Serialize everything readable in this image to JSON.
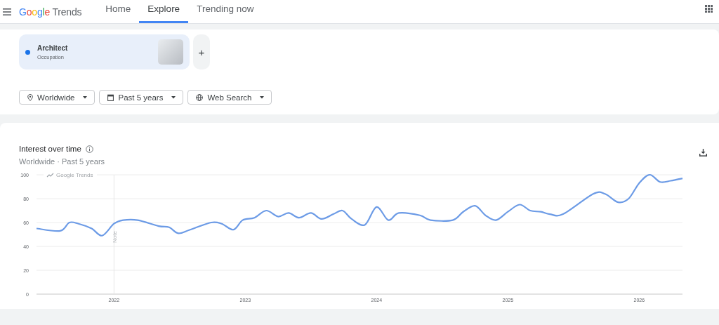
{
  "header": {
    "logo": "Google Trends",
    "nav": [
      {
        "label": "Home",
        "selected": false
      },
      {
        "label": "Explore",
        "selected": true
      },
      {
        "label": "Trending now",
        "selected": false
      }
    ]
  },
  "terms": [
    {
      "name": "Architect",
      "category": "Occupation",
      "color": "#1a73e8"
    }
  ],
  "add_term": {
    "label": "+"
  },
  "filters": [
    {
      "kind": "location",
      "label": "Worldwide"
    },
    {
      "kind": "time",
      "label": "Past 5 years"
    },
    {
      "kind": "property",
      "label": "Web Search"
    }
  ],
  "interest_over_time": {
    "title": "Interest over time",
    "subtitle": "Worldwide · Past 5 years",
    "chart_badge": "Google Trends",
    "chart_data": {
      "type": "line",
      "xlim": [
        2021.41,
        2026.33
      ],
      "ylim": [
        0,
        100
      ],
      "xticks": [
        {
          "value": 2022,
          "label": "2022"
        },
        {
          "value": 2023,
          "label": "2023"
        },
        {
          "value": 2024,
          "label": "2024"
        },
        {
          "value": 2025,
          "label": "2025"
        },
        {
          "value": 2026,
          "label": "2026"
        }
      ],
      "yticks": [
        0,
        20,
        40,
        60,
        80,
        100
      ],
      "grid": true,
      "ref_lines": [
        {
          "axis": "x",
          "value": 2022,
          "label": "Note"
        }
      ],
      "x": [
        2021.41,
        2021.59,
        2021.66,
        2021.73,
        2021.83,
        2021.91,
        2022.0,
        2022.07,
        2022.18,
        2022.34,
        2022.42,
        2022.49,
        2022.58,
        2022.74,
        2022.82,
        2022.91,
        2022.98,
        2023.07,
        2023.16,
        2023.25,
        2023.33,
        2023.41,
        2023.5,
        2023.58,
        2023.67,
        2023.74,
        2023.81,
        2023.91,
        2024.0,
        2024.09,
        2024.17,
        2024.33,
        2024.41,
        2024.58,
        2024.66,
        2024.75,
        2024.83,
        2024.91,
        2025.0,
        2025.09,
        2025.17,
        2025.25,
        2025.32,
        2025.42,
        2025.65,
        2025.74,
        2025.84,
        2025.92,
        2026.0,
        2026.08,
        2026.16,
        2026.24,
        2026.33
      ],
      "series": [
        {
          "color": "#6c9be6",
          "values": [
            55,
            53,
            60,
            59,
            55,
            49,
            59,
            62,
            62,
            57,
            56,
            51,
            54,
            60,
            59,
            54,
            62,
            64,
            70,
            65,
            68,
            64,
            68,
            63,
            67,
            70,
            63,
            58,
            73,
            62,
            68,
            66,
            62,
            62,
            69,
            74,
            66,
            62,
            69,
            75,
            70,
            69,
            67,
            67,
            84,
            84,
            77,
            80,
            93,
            100,
            94,
            95,
            97
          ]
        }
      ]
    }
  }
}
